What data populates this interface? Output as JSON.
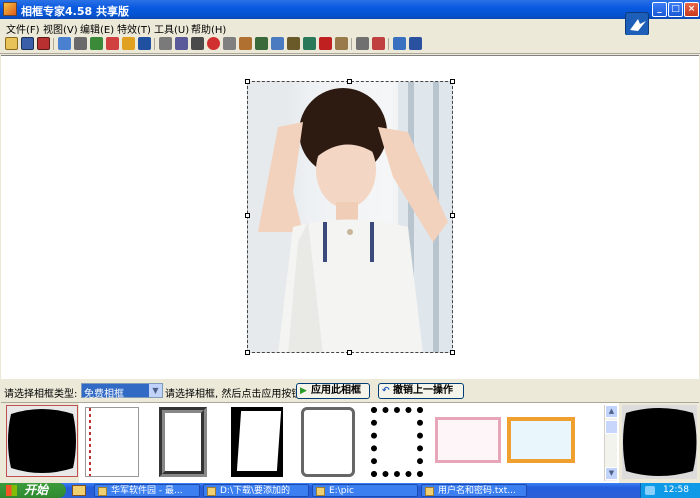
{
  "window": {
    "title": "相框专家4.58 共享版"
  },
  "menu": [
    {
      "label": "文件(F)"
    },
    {
      "label": "视图(V)"
    },
    {
      "label": "编辑(E)"
    },
    {
      "label": "特效(T)"
    },
    {
      "label": "工具(U)"
    },
    {
      "label": "帮助(H)"
    }
  ],
  "controls": {
    "frame_type_label": "请选择相框类型:",
    "frame_type_value": "免费相框",
    "hint": "请选择相框, 然后点击应用按钮:",
    "apply_label": "应用此相框",
    "undo_label": "撤销上一操作"
  },
  "taskbar": {
    "start_label": "开始",
    "tasks": [
      {
        "label": "华军软件园 - 最..."
      },
      {
        "label": "D:\\下载\\要添加的"
      },
      {
        "label": "E:\\pic"
      },
      {
        "label": "用户名和密码.txt..."
      }
    ],
    "clock": "12:58"
  },
  "icons": {
    "title_buttons": [
      "minimize-icon",
      "maximize-icon",
      "close-icon"
    ],
    "toolbar": [
      "open-icon",
      "save-icon",
      "save-as-icon",
      "undo-icon",
      "copy-icon",
      "rotate-icon",
      "flip-icon",
      "redo-icon",
      "crop-icon",
      "zoom-icon",
      "text-icon",
      "effect-icon",
      "frame-icon",
      "color-icon",
      "filter-icon",
      "print-icon",
      "export-icon",
      "help-icon"
    ]
  },
  "colors": {
    "titlebar": "#0a5ae0",
    "selection": "#316ac5",
    "taskbar": "#245edc",
    "start": "#2f8a2f"
  }
}
